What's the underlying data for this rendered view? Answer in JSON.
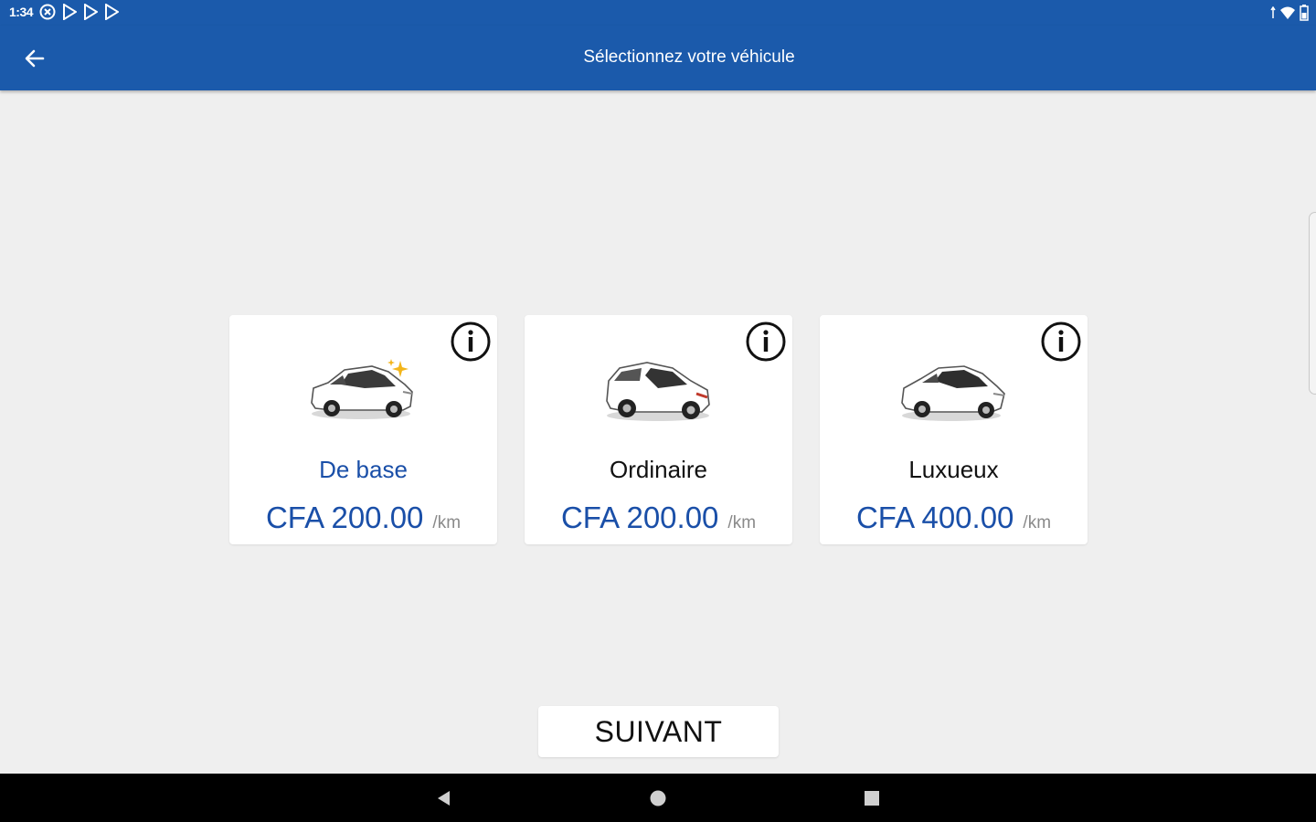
{
  "status_bar": {
    "time": "1:34"
  },
  "app_bar": {
    "title": "Sélectionnez votre véhicule"
  },
  "vehicles": [
    {
      "name": "De base",
      "price": "CFA 200.00",
      "unit": "/km",
      "selected": true
    },
    {
      "name": "Ordinaire",
      "price": "CFA 200.00",
      "unit": "/km",
      "selected": false
    },
    {
      "name": "Luxueux",
      "price": "CFA 400.00",
      "unit": "/km",
      "selected": false
    }
  ],
  "next_button": {
    "label": "SUIVANT"
  },
  "colors": {
    "primary": "#1b5aab",
    "price_text": "#1a4fa8",
    "background": "#efefef"
  },
  "icons": [
    "back-arrow-icon",
    "info-icon",
    "car-icon",
    "sparkle-icon",
    "nav-back-icon",
    "nav-home-icon",
    "nav-recents-icon"
  ]
}
